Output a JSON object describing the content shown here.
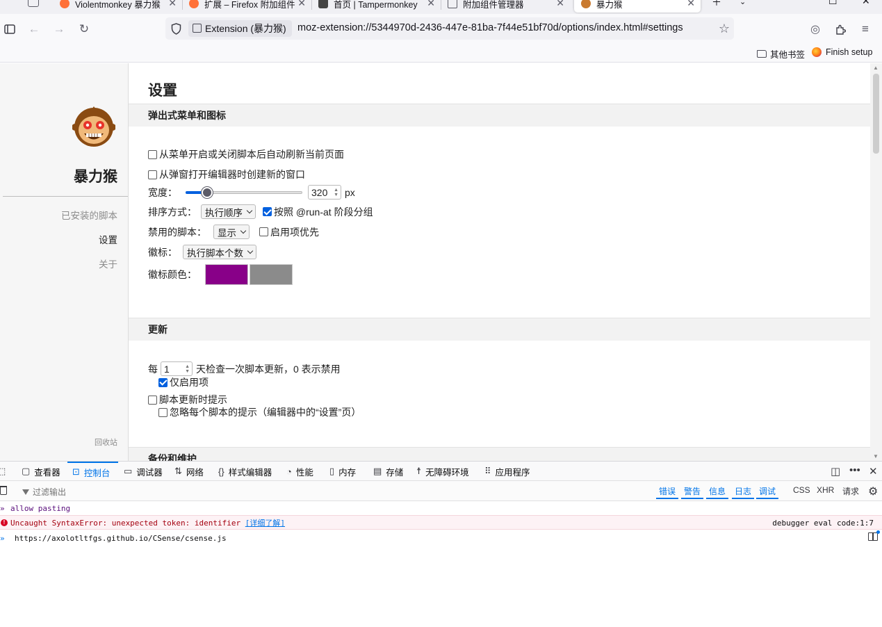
{
  "browser": {
    "tabs": [
      {
        "title": "Violentmonkey 暴力猴",
        "favicon_color": "#ff7139"
      },
      {
        "title": "扩展 – Firefox 附加组件",
        "favicon_color": "#ff7139"
      },
      {
        "title": "首页 | Tampermonkey",
        "favicon_color": "#444444"
      },
      {
        "title": "附加组件管理器",
        "favicon_color": "#5b5b66"
      },
      {
        "title": "暴力猴",
        "favicon_color": "#c97a2f"
      }
    ],
    "extension_label": "Extension (暴力猴)",
    "url": "moz-extension://5344970d-2436-447e-81ba-7f44e51bf70d/options/index.html#settings",
    "bookmarks": [
      {
        "label": "其他书签",
        "icon": "folder-icon"
      },
      {
        "label": "Finish setup",
        "icon": "firefox-icon"
      }
    ]
  },
  "sidebar": {
    "app_name": "暴力猴",
    "items": [
      {
        "label": "已安装的脚本"
      },
      {
        "label": "设置"
      },
      {
        "label": "关于"
      }
    ],
    "footer": "回收站"
  },
  "settings": {
    "title": "设置",
    "popup_section": {
      "heading": "弹出式菜单和图标",
      "autoreload_label": "从菜单开启或关闭脚本后自动刷新当前页面",
      "autoreload_checked": false,
      "new_window_label": "从弹窗打开编辑器时创建新的窗口",
      "new_window_checked": false,
      "width_label": "宽度：",
      "width_value": "320",
      "width_unit": "px",
      "width_slider_fraction": 0.15,
      "sort_label": "排序方式：",
      "sort_value": "执行顺序",
      "group_runat_label": "按照 @run-at 阶段分组",
      "group_runat_checked": true,
      "disabled_label": "禁用的脚本：",
      "disabled_value": "显示",
      "enabled_first_label": "启用项优先",
      "enabled_first_checked": false,
      "badge_label": "徽标：",
      "badge_value": "执行脚本个数",
      "badge_color_label": "徽标颜色：",
      "badge_colors": [
        "#880088",
        "#8b8b8b"
      ]
    },
    "update_section": {
      "heading": "更新",
      "every_label": "每",
      "interval_value": "1",
      "interval_suffix": "天检查一次脚本更新，0 表示禁用",
      "enabled_only_label": "仅启用项",
      "enabled_only_checked": true,
      "notify_label": "脚本更新时提示",
      "notify_checked": false,
      "ignore_label": "忽略每个脚本的提示（编辑器中的“设置”页）",
      "ignore_checked": false
    },
    "backup_section": {
      "heading": "备份和维护"
    }
  },
  "devtools": {
    "tabs": [
      {
        "label": "查看器",
        "icon": "inspector-icon"
      },
      {
        "label": "控制台",
        "icon": "console-icon"
      },
      {
        "label": "调试器",
        "icon": "debugger-icon"
      },
      {
        "label": "网络",
        "icon": "network-icon"
      },
      {
        "label": "样式编辑器",
        "icon": "style-editor-icon"
      },
      {
        "label": "性能",
        "icon": "performance-icon"
      },
      {
        "label": "内存",
        "icon": "memory-icon"
      },
      {
        "label": "存储",
        "icon": "storage-icon"
      },
      {
        "label": "无障碍环境",
        "icon": "accessibility-icon"
      },
      {
        "label": "应用程序",
        "icon": "application-icon"
      }
    ],
    "active_tab": "控制台",
    "filter_placeholder": "过滤输出",
    "levels": [
      "错误",
      "警告",
      "信息",
      "日志",
      "调试"
    ],
    "extra_filters": [
      "CSS",
      "XHR",
      "请求"
    ],
    "console": {
      "input_line": "allow pasting",
      "error_message": "Uncaught SyntaxError: unexpected token: identifier",
      "error_link": "[详细了解]",
      "error_location": "debugger eval code:1:7",
      "prompt_text": "https://axolotltfgs.github.io/CSense/csense.js"
    }
  }
}
